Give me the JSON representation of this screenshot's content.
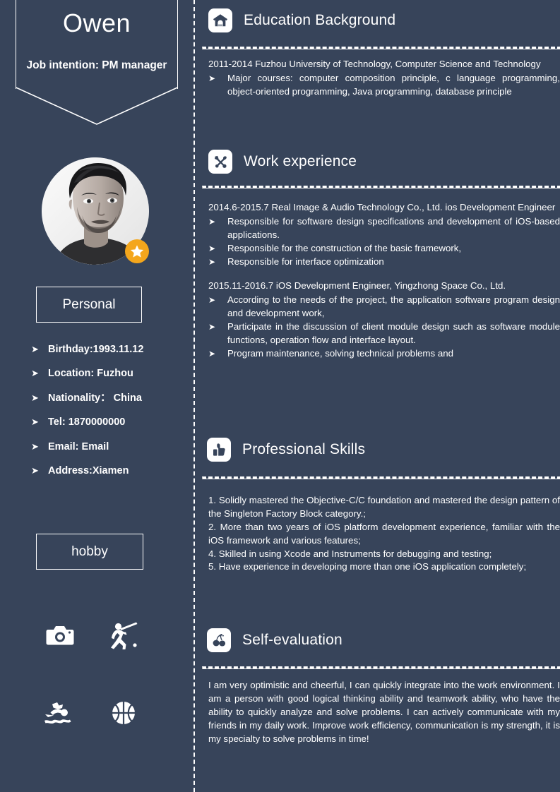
{
  "theme": {
    "background": "#37445a",
    "text": "#ffffff",
    "accent": "#f4a61c",
    "icon_tile": "#ffffff",
    "icon_glyph": "#37445a"
  },
  "left": {
    "name": "Owen",
    "job_intention": "Job intention: PM manager",
    "photo": {
      "alt": "portrait-photo",
      "badge_icon": "star-icon"
    },
    "personal_heading": "Personal",
    "bullet_mark": "➤",
    "personal_items": [
      {
        "text": "Birthday:1993.11.12",
        "gap_before": false
      },
      {
        "text": "Location: Fuzhou",
        "gap_before": false
      },
      {
        "text": "Nationality： China",
        "gap_before": false
      },
      {
        "text": "Tel: 1870000000",
        "gap_before": true
      },
      {
        "text": "Email: Email",
        "gap_before": false
      },
      {
        "text": "Address:Xiamen",
        "gap_before": false
      }
    ],
    "hobby_heading": "hobby",
    "hobby_icons": [
      "camera-icon",
      "baseball-player-icon",
      "swimming-icon",
      "basketball-icon"
    ]
  },
  "sections": {
    "education": {
      "title": "Education Background",
      "icon": "school-house-icon",
      "entry_title": "2011-2014 Fuzhou University of Technology, Computer Science and Technology",
      "bullets": [
        "Major courses: computer composition principle, c language programming, object-oriented programming, Java programming, database principle"
      ]
    },
    "work": {
      "title": "Work experience",
      "icon": "tools-icon",
      "jobs": [
        {
          "entry_title": "2014.6-2015.7 Real Image & Audio Technology Co., Ltd. ios Development Engineer",
          "bullets": [
            "Responsible for software design specifications and development of iOS-based applications.",
            "Responsible for the construction of the basic framework,",
            "Responsible for interface optimization"
          ]
        },
        {
          "entry_title": "2015.11-2016.7 iOS Development Engineer, Yingzhong Space Co., Ltd.",
          "bullets": [
            "According to the needs of the project, the application software program design and development work,",
            "Participate in the discussion of client module design such as software module functions, operation flow and interface layout.",
            "Program maintenance, solving technical problems and"
          ]
        }
      ]
    },
    "skills": {
      "title": "Professional Skills",
      "icon": "thumbs-up-icon",
      "lines": [
        "1. Solidly mastered the Objective-C/C foundation and mastered the design pattern of the Singleton Factory Block category.;",
        "2. More than two years of iOS platform development experience, familiar with the iOS framework and various features;",
        "4. Skilled in using Xcode and Instruments for debugging and testing;",
        "5. Have experience in developing more than one iOS application completely;"
      ]
    },
    "self_evaluation": {
      "title": "Self-evaluation",
      "icon": "cherries-icon",
      "text": "I am very optimistic and cheerful, I can quickly integrate into the work environment. I am a person with good logical thinking ability and teamwork ability, who have the ability to quickly analyze and solve problems. I can actively communicate with my friends in my daily work. Improve work efficiency, communication is my strength, it is my specialty to solve problems in time!"
    }
  }
}
